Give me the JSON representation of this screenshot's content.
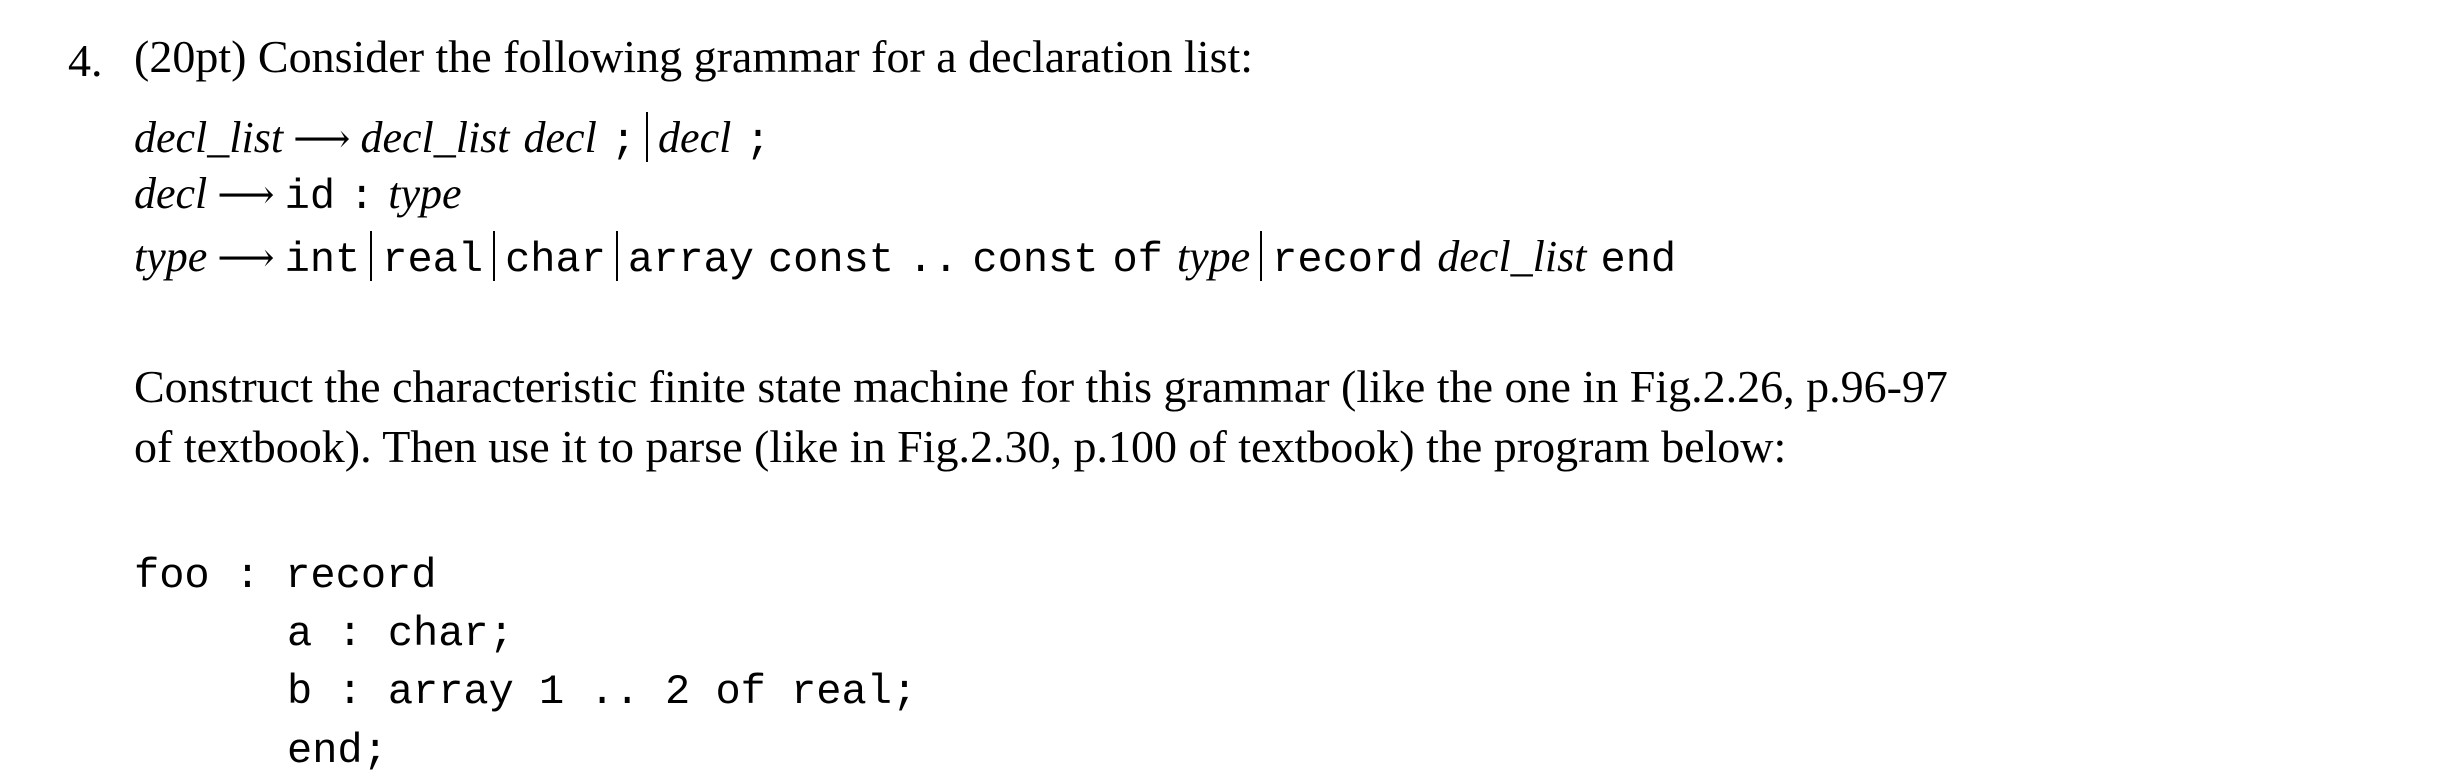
{
  "question": {
    "number": "4.",
    "points": "(20pt)",
    "heading": "(20pt) Consider the following grammar for a declaration list:"
  },
  "grammar": {
    "arrow_symbol": "⟶",
    "separator_symbol": "|",
    "rules": [
      {
        "lhs": "decl_list",
        "alternatives": [
          [
            {
              "kind": "nonterminal",
              "text": "decl_list"
            },
            {
              "kind": "nonterminal",
              "text": "decl"
            },
            {
              "kind": "terminal",
              "text": ";"
            }
          ],
          [
            {
              "kind": "nonterminal",
              "text": "decl"
            },
            {
              "kind": "terminal",
              "text": ";"
            }
          ]
        ]
      },
      {
        "lhs": "decl",
        "alternatives": [
          [
            {
              "kind": "terminal",
              "text": "id"
            },
            {
              "kind": "terminal",
              "text": ":"
            },
            {
              "kind": "nonterminal",
              "text": "type"
            }
          ]
        ]
      },
      {
        "lhs": "type",
        "alternatives": [
          [
            {
              "kind": "terminal",
              "text": "int"
            }
          ],
          [
            {
              "kind": "terminal",
              "text": "real"
            }
          ],
          [
            {
              "kind": "terminal",
              "text": "char"
            }
          ],
          [
            {
              "kind": "terminal",
              "text": "array"
            },
            {
              "kind": "terminal",
              "text": "const"
            },
            {
              "kind": "terminal",
              "text": ".."
            },
            {
              "kind": "terminal",
              "text": "const"
            },
            {
              "kind": "terminal",
              "text": "of"
            },
            {
              "kind": "nonterminal",
              "text": "type"
            }
          ],
          [
            {
              "kind": "terminal",
              "text": "record"
            },
            {
              "kind": "nonterminal",
              "text": "decl_list"
            },
            {
              "kind": "terminal",
              "text": "end"
            }
          ]
        ]
      }
    ]
  },
  "instructions": {
    "line1": "Construct the characteristic finite state machine for this grammar (like the one in Fig.2.26, p.96-97",
    "line2": "of textbook). Then use it to parse (like in Fig.2.30, p.100 of textbook) the program below:"
  },
  "program": {
    "lines": [
      "foo : record",
      "a : char;",
      "b : array 1 .. 2 of real;",
      "end;"
    ]
  }
}
